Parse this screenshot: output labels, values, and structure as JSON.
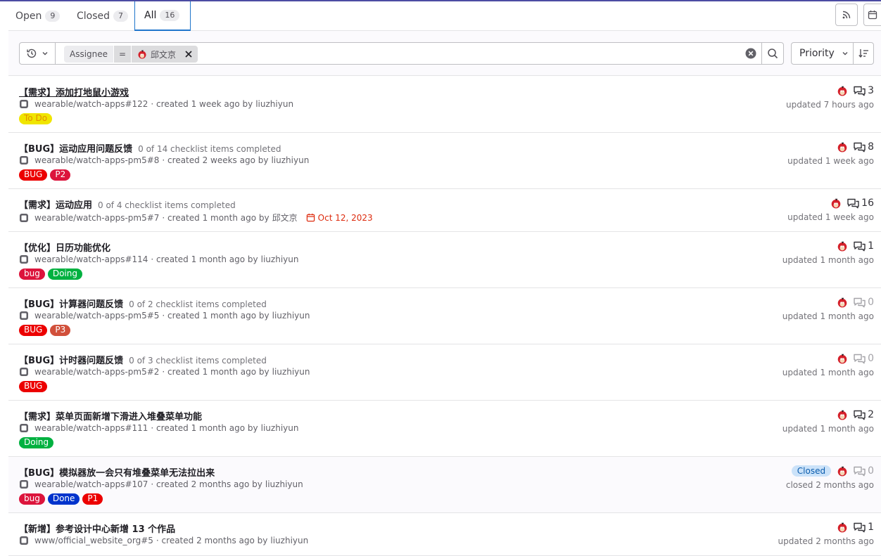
{
  "tabs": [
    {
      "label": "Open",
      "count": "9"
    },
    {
      "label": "Closed",
      "count": "7"
    },
    {
      "label": "All",
      "count": "16"
    }
  ],
  "filter": {
    "token_name": "Assignee",
    "token_op": "=",
    "token_value": "邱文京",
    "sort_label": "Priority"
  },
  "colors": {
    "accent": "#1f75cb",
    "label_todo": "#f0e500",
    "label_bug": "#ec0000",
    "label_bug_lower": "#dc143c",
    "label_doing": "#00b140",
    "label_done": "#0033cc",
    "label_p3": "#d1503b"
  },
  "issues": [
    {
      "title": "【需求】添加打地鼠小游戏",
      "checklist": "",
      "ref": "wearable/watch-apps#122",
      "created": "· created 1 week ago by",
      "author": "liuzhiyun",
      "due": "",
      "labels": [
        {
          "text": "To Do",
          "color": "#f0e500",
          "fg": "#e58d00"
        }
      ],
      "status": "",
      "comments": "3",
      "updated": "updated 7 hours ago"
    },
    {
      "title": "【BUG】运动应用问题反馈",
      "checklist": "0 of 14 checklist items completed",
      "ref": "wearable/watch-apps-pm5#8",
      "created": "· created 2 weeks ago by",
      "author": "liuzhiyun",
      "due": "",
      "labels": [
        {
          "text": "BUG",
          "color": "#ec0000",
          "fg": "#ffffff"
        },
        {
          "text": "P2",
          "color": "#dc143c",
          "fg": "#ffffff"
        }
      ],
      "status": "",
      "comments": "8",
      "updated": "updated 1 week ago"
    },
    {
      "title": "【需求】运动应用",
      "checklist": "0 of 4 checklist items completed",
      "ref": "wearable/watch-apps-pm5#7",
      "created": "· created 1 month ago by",
      "author": "邱文京",
      "due": "Oct 12, 2023",
      "labels": [],
      "status": "",
      "comments": "16",
      "updated": "updated 1 week ago"
    },
    {
      "title": "【优化】日历功能优化",
      "checklist": "",
      "ref": "wearable/watch-apps#114",
      "created": "· created 1 month ago by",
      "author": "liuzhiyun",
      "due": "",
      "labels": [
        {
          "text": "bug",
          "color": "#dc143c",
          "fg": "#ffffff"
        },
        {
          "text": "Doing",
          "color": "#00b140",
          "fg": "#ffffff"
        }
      ],
      "status": "",
      "comments": "1",
      "updated": "updated 1 month ago"
    },
    {
      "title": "【BUG】计算器问题反馈",
      "checklist": "0 of 2 checklist items completed",
      "ref": "wearable/watch-apps-pm5#5",
      "created": "· created 1 month ago by",
      "author": "liuzhiyun",
      "due": "",
      "labels": [
        {
          "text": "BUG",
          "color": "#ec0000",
          "fg": "#ffffff"
        },
        {
          "text": "P3",
          "color": "#d1503b",
          "fg": "#ffffff"
        }
      ],
      "status": "",
      "comments": "0",
      "updated": "updated 1 month ago"
    },
    {
      "title": "【BUG】计时器问题反馈",
      "checklist": "0 of 3 checklist items completed",
      "ref": "wearable/watch-apps-pm5#2",
      "created": "· created 1 month ago by",
      "author": "liuzhiyun",
      "due": "",
      "labels": [
        {
          "text": "BUG",
          "color": "#ec0000",
          "fg": "#ffffff"
        }
      ],
      "status": "",
      "comments": "0",
      "updated": "updated 1 month ago"
    },
    {
      "title": "【需求】菜单页面新增下滑进入堆叠菜单功能",
      "checklist": "",
      "ref": "wearable/watch-apps#111",
      "created": "· created 1 month ago by",
      "author": "liuzhiyun",
      "due": "",
      "labels": [
        {
          "text": "Doing",
          "color": "#00b140",
          "fg": "#ffffff"
        }
      ],
      "status": "",
      "comments": "2",
      "updated": "updated 1 month ago"
    },
    {
      "title": "【BUG】模拟器放一会只有堆叠菜单无法拉出来",
      "checklist": "",
      "ref": "wearable/watch-apps#107",
      "created": "· created 2 months ago by",
      "author": "liuzhiyun",
      "due": "",
      "labels": [
        {
          "text": "bug",
          "color": "#dc143c",
          "fg": "#ffffff"
        },
        {
          "text": "Done",
          "color": "#0033cc",
          "fg": "#ffffff"
        },
        {
          "text": "P1",
          "color": "#ec0000",
          "fg": "#ffffff"
        }
      ],
      "status": "Closed",
      "comments": "0",
      "updated": "closed 2 months ago"
    },
    {
      "title": "【新增】参考设计中心新增 13 个作品",
      "checklist": "",
      "ref": "www/official_website_org#5",
      "created": "· created 2 months ago by",
      "author": "liuzhiyun",
      "due": "",
      "labels": [],
      "status": "",
      "comments": "1",
      "updated": "updated 2 months ago"
    }
  ]
}
